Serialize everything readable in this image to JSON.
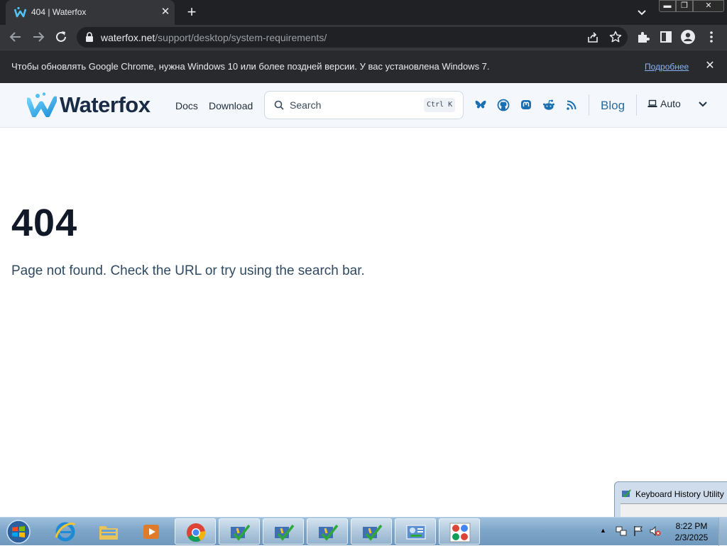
{
  "browser": {
    "tab": {
      "title": "404 | Waterfox"
    },
    "address": {
      "host": "waterfox.net",
      "path": "/support/desktop/system-requirements/"
    },
    "infobar": {
      "message": "Чтобы обновлять Google Chrome, нужна Windows 10 или более поздней версии. У вас установлена Windows 7.",
      "link": "Подробнее"
    }
  },
  "site": {
    "logo_text": "Waterfox",
    "nav": {
      "docs": "Docs",
      "download": "Download",
      "blog": "Blog"
    },
    "search": {
      "placeholder": "Search",
      "shortcut": "Ctrl K"
    },
    "theme": {
      "label": "Auto"
    },
    "colors": {
      "brand_dark": "#1a2c45",
      "brand_accent": "#2fa4e7",
      "link": "#2a6a9e"
    }
  },
  "content": {
    "code": "404",
    "message": "Page not found. Check the URL or try using the search bar."
  },
  "popup": {
    "title": "Keyboard History Utility"
  },
  "taskbar": {
    "time": "8:22 PM",
    "date": "2/3/2025"
  }
}
